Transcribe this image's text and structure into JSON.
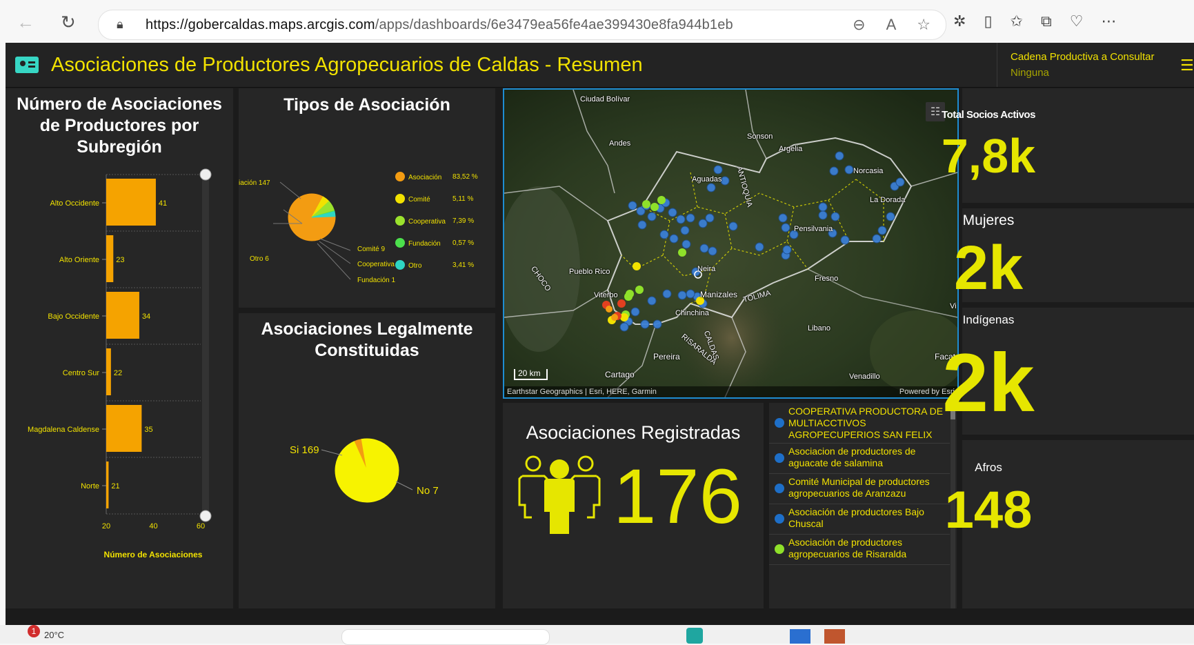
{
  "browser": {
    "url_host": "https://gobercaldas.maps.arcgis.com",
    "url_path": "/apps/dashboards/6e3479ea56fe4ae399430e8fa944b1eb"
  },
  "header": {
    "title": "Asociaciones de Productores Agropecuarios de Caldas - Resumen",
    "selector_label": "Cadena Productiva a Consultar",
    "selector_value": "Ninguna"
  },
  "bar_panel": {
    "title_line1": "Número de Asociaciones",
    "title_line2": "de Productores por",
    "title_line3": "Subregión",
    "xlabel": "Número de Asociaciones",
    "ticks": [
      "20",
      "40",
      "60"
    ]
  },
  "pie_panel": {
    "title": "Tipos de Asociación",
    "labels": {
      "asociacion": "iación 147",
      "otro": "Otro 6",
      "comite": "Comité 9",
      "cooperativa": "Cooperativa",
      "fundacion": "Fundación 1"
    },
    "legend": [
      {
        "name": "Asociación",
        "pct": "83,52 %",
        "color": "#f39c12"
      },
      {
        "name": "Comité",
        "pct": "5,11 %",
        "color": "#f2e200"
      },
      {
        "name": "Cooperativa",
        "pct": "7,39 %",
        "color": "#9be22d"
      },
      {
        "name": "Fundación",
        "pct": "0,57 %",
        "color": "#4ce04c"
      },
      {
        "name": "Otro",
        "pct": "3,41 %",
        "color": "#2fd6c3"
      }
    ]
  },
  "legal_panel": {
    "title_line1": "Asociaciones Legalmente",
    "title_line2": "Constituidas",
    "si_label": "Si 169",
    "no_label": "No 7"
  },
  "map": {
    "labels": {
      "ciudad_bolivar": "Ciudad Bolívar",
      "andes": "Andes",
      "sonson": "Sonson",
      "argelia": "Argelia",
      "aguadas": "Aguadas",
      "antioquia": "ANTIOQUIA",
      "norcasia": "Norcasia",
      "la_dorada": "La Dorada",
      "pensilvania": "Pensilvania",
      "pueblo_rico": "Pueblo Rico",
      "choco": "CHOCO",
      "neira": "Neira",
      "fresno": "Fresno",
      "viterbo": "Viterbo",
      "manizales": "Manizales",
      "tolima": "TOLIMA",
      "chinchina": "Chinchina",
      "libano": "Libano",
      "risaralda": "RISARALDA",
      "caldas": "CALDAS",
      "pereira": "Pereira",
      "cartago": "Cartago",
      "venadillo": "Venadillo",
      "facat": "Facat",
      "vi": "Vi"
    },
    "scale": "20 km",
    "attribution": "Earthstar Geographics | Esri, HERE, Garmin",
    "powered": "Powered by Esri"
  },
  "registradas": {
    "title": "Asociaciones Registradas",
    "value": "176"
  },
  "list": [
    {
      "text": "COOPERATIVA PRODUCTORA DE MULTIACCTIVOS AGROPECUPERIOS SAN FELIX",
      "color": "#1e6fc8"
    },
    {
      "text": "Asociacion de productores de aguacate de salamina",
      "color": "#1e6fc8"
    },
    {
      "text": "Comité Municipal de productores agropecuarios de Aranzazu",
      "color": "#1e6fc8"
    },
    {
      "text": "Asociación de productores Bajo Chuscal",
      "color": "#1e6fc8"
    },
    {
      "text": "Asociación de productores agropecuarios de Risaralda",
      "color": "#8fe02a"
    }
  ],
  "kpis": {
    "socios": {
      "title": "Total Socios Activos",
      "value": "7,8k"
    },
    "mujeres": {
      "title": "Mujeres",
      "value": "2k"
    },
    "indigenas": {
      "title": "Indígenas",
      "value": "2k"
    },
    "afros": {
      "title": "Afros",
      "value": "148"
    }
  },
  "taskbar": {
    "badge": "1",
    "weather": "20°C"
  },
  "chart_data": [
    {
      "type": "bar",
      "title": "Número de Asociaciones de Productores por Subregión",
      "xlabel": "Número de Asociaciones",
      "ylabel": "",
      "orientation": "horizontal",
      "categories": [
        "Alto Occidente",
        "Alto Oriente",
        "Bajo Occidente",
        "Centro Sur",
        "Magdalena Caldense",
        "Norte"
      ],
      "values": [
        41,
        23,
        34,
        22,
        35,
        21
      ],
      "xlim": [
        20,
        60
      ],
      "color": "#f5a300"
    },
    {
      "type": "pie",
      "title": "Tipos de Asociación",
      "categories": [
        "Asociación",
        "Comité",
        "Cooperativa",
        "Fundación",
        "Otro"
      ],
      "values": [
        147,
        9,
        13,
        1,
        6
      ],
      "percentages": [
        83.52,
        5.11,
        7.39,
        0.57,
        3.41
      ]
    },
    {
      "type": "pie",
      "title": "Asociaciones Legalmente Constituidas",
      "categories": [
        "Si",
        "No"
      ],
      "values": [
        169,
        7
      ],
      "colors": [
        "#f7f300",
        "#f39c12"
      ]
    }
  ]
}
